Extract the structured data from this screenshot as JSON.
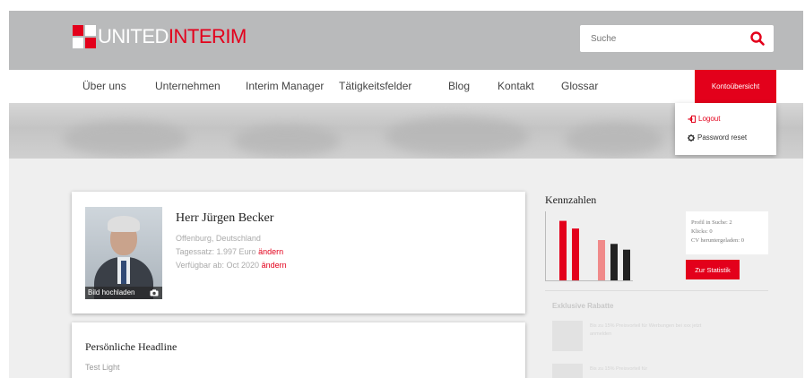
{
  "header": {
    "logo": {
      "text_white": "UNITED",
      "text_red": "INTERIM"
    },
    "search": {
      "placeholder": "Suche"
    }
  },
  "nav": {
    "items": [
      "Über uns",
      "Unternehmen",
      "Interim Manager",
      "Tätigkeitsfelder",
      "Blog",
      "Kontakt",
      "Glossar"
    ],
    "account_label": "Kontoübersicht"
  },
  "account_menu": {
    "logout": "Logout",
    "password_reset": "Password reset"
  },
  "profile": {
    "name": "Herr Jürgen Becker",
    "location": "Offenburg, Deutschland",
    "rate_label": "Tagessatz: 1.997 Euro",
    "rate_edit": "ändern",
    "available_label": "Verfügbar ab: Oct 2020",
    "available_edit": "ändern",
    "upload_label": "Bild hochladen"
  },
  "headline_card": {
    "title": "Persönliche Headline",
    "value": "Test Light"
  },
  "kennzahlen": {
    "title": "Kennzahlen",
    "stats": [
      "Profil in Suche: 2",
      "Klicks: 0",
      "CV heruntergeladen: 0"
    ],
    "button": "Zur Statistik"
  },
  "chart_data": {
    "type": "bar",
    "values": [
      62,
      54,
      42,
      38,
      32
    ],
    "colors": [
      "#e3001b",
      "#e3001b",
      "#f08a8a",
      "#222222",
      "#222222"
    ],
    "ylim": [
      0,
      70
    ]
  },
  "rabatte": {
    "title": "Exklusive Rabatte",
    "items": [
      {
        "text": "Bis zu 15% Preisvorteil für Werbungen bei xxx jetzt anmelden"
      },
      {
        "text": "Bis zu 15% Preisvorteil für"
      }
    ]
  },
  "colors": {
    "brand_red": "#e3001b",
    "topbar_gray": "#b9babb"
  }
}
